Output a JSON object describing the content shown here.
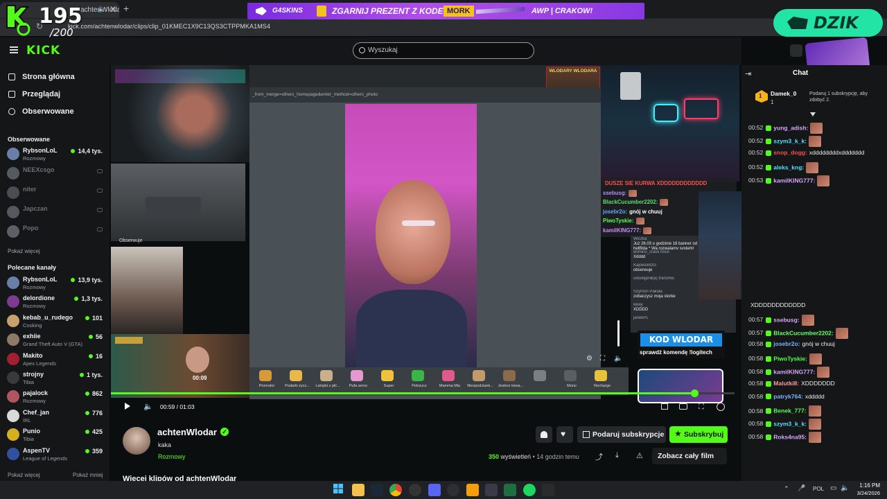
{
  "browser": {
    "tab_title": "achtenWlodar - Watch clip",
    "url": "kick.com/achtenwlodar/clips/clip_01KMEC1X9C13QS3CTPPMKA1MS4"
  },
  "overlay_counter": {
    "value": "195",
    "goal": "/200"
  },
  "promo_banner": {
    "brand": "G4SKINS",
    "text": "ZGARNIJ PREZENT Z KODEM",
    "code": "MORK",
    "tail": "AWP | CRAKOW!"
  },
  "dzik_badge": {
    "label": "DZIK"
  },
  "kick_header": {
    "logo": "KICK",
    "search_placeholder": "Wyszukaj"
  },
  "sidebar": {
    "nav": [
      {
        "label": "Strona główna",
        "icon": "home-icon"
      },
      {
        "label": "Przeglądaj",
        "icon": "browse-icon"
      },
      {
        "label": "Obserwowane",
        "icon": "heart-icon"
      }
    ],
    "followed_title": "Obserwowane",
    "followed": [
      {
        "name": "RybsonLoL",
        "category": "Rozmowy",
        "viewers": "14,4 tys.",
        "live": true,
        "color": "#6a7fa8"
      },
      {
        "name": "NEEXcsgo",
        "category": "",
        "viewers": "",
        "live": false,
        "color": "#555a60"
      },
      {
        "name": "niter",
        "category": "",
        "viewers": "",
        "live": false,
        "color": "#4a4e53"
      },
      {
        "name": "Japczan",
        "category": "",
        "viewers": "",
        "live": false,
        "color": "#55595e"
      },
      {
        "name": "Popo",
        "category": "",
        "viewers": "",
        "live": false,
        "color": "#5c5f63"
      }
    ],
    "show_more": "Pokaż więcej",
    "recommended_title": "Polecane kanały",
    "recommended": [
      {
        "name": "RybsonLoL",
        "category": "Rozmowy",
        "viewers": "13,9 tys.",
        "color": "#6a7fa8"
      },
      {
        "name": "delordione",
        "category": "Rozmowy",
        "viewers": "1,3 tys.",
        "color": "#7d3b8f"
      },
      {
        "name": "kebab_u_rudego",
        "category": "Cooking",
        "viewers": "101",
        "color": "#c8a070"
      },
      {
        "name": "exhiie",
        "category": "Grand Theft Auto V (GTA)",
        "viewers": "56",
        "color": "#8c7a66"
      },
      {
        "name": "Makito",
        "category": "Apex Legends",
        "viewers": "16",
        "color": "#a02030"
      },
      {
        "name": "strojny",
        "category": "Tibia",
        "viewers": "1 tys.",
        "color": "#3a3a3a"
      },
      {
        "name": "pajalock",
        "category": "Rozmowy",
        "viewers": "862",
        "color": "#b05560"
      },
      {
        "name": "Chef_jan",
        "category": "IRL",
        "viewers": "776",
        "color": "#d9d9d9"
      },
      {
        "name": "Punio",
        "category": "Tibia",
        "viewers": "425",
        "color": "#d4b020"
      },
      {
        "name": "AspenTV",
        "category": "League of Legends",
        "viewers": "359",
        "color": "#3050a0"
      }
    ],
    "footer_more": "Pokaż więcej",
    "footer_less": "Pokaż mniej"
  },
  "player": {
    "mini_timer": "00:09",
    "time": "00:59 / 01:03",
    "progress": 0.936
  },
  "stream_page": {
    "url_fragment": "_from_merge=others_homepage&enter_method=others_photo",
    "gifts": [
      "Promotor",
      "Podarki życz...",
      "Lampki z płć...",
      "Pufa serce",
      "Super",
      "Petrzucz",
      "Mamma Mia",
      "Niespodziank...",
      "Jestesi niesa...",
      "",
      "Mono",
      "Recharge"
    ],
    "kod_title": "KOD WLODAR",
    "kod_sub": "sprawdź komendę !logitech",
    "wloldary": "WLODARY WLODARA"
  },
  "overlay_chat": [
    {
      "user": "",
      "text": "DUSZE SIE KURWA XDDDDDDDDDDDD",
      "color": "#ff5050"
    },
    {
      "user": "ssebusg:",
      "text": "",
      "color": "#b48cff"
    },
    {
      "user": "BlackCucumber2202:",
      "text": "",
      "color": "#5ee06a"
    },
    {
      "user": "josebr2o:",
      "text": "gnój w chuuj",
      "color": "#6aa8ff"
    },
    {
      "user": "PiwoTyskie:",
      "text": "",
      "color": "#56ff56"
    },
    {
      "user": "kamilKING777:",
      "text": "",
      "color": "#c88cff"
    }
  ],
  "side_overlay": {
    "username_label": "Obserwuje",
    "chat": [
      {
        "user": "Wiczka",
        "text": "Już 26.03 o godzinie 18 banner od hellfilda * Wa rozwalamy system!"
      },
      {
        "user": "domino_crack hous",
        "text": "Xdddd"
      },
      {
        "user": "KajowskiOG",
        "text": "obserwuje"
      },
      {
        "user": "udostępnił(a) transmis",
        "text": ""
      },
      {
        "user": "Szymon Pakoła",
        "text": "zobaczysz moja storke"
      },
      {
        "user": "kewy",
        "text": "XDDDD"
      },
      {
        "user": "janekPL",
        "text": ""
      }
    ]
  },
  "chat": {
    "header": "Chat",
    "top_supporter": {
      "name": "Damek_0",
      "count": "1"
    },
    "subgift_prompt": "Podaruj 1 subskrypcję, aby zdobyć 2.",
    "messages_top": [
      {
        "time": "00:52",
        "user": "yung_adish:",
        "text": "",
        "color": "#d7a7ff",
        "emote": true
      },
      {
        "time": "00:52",
        "user": "szym3_k_k:",
        "text": "",
        "color": "#56e0ff",
        "emote": true
      },
      {
        "time": "00:52",
        "user": "snop_dogg:",
        "text": "xddddddddxddddddd",
        "color": "#ff4d4d",
        "emote": false
      },
      {
        "time": "00:52",
        "user": "aleks_kng:",
        "text": "",
        "color": "#56e0ff",
        "emote": true
      },
      {
        "time": "00:53",
        "user": "kamilKING777:",
        "text": "",
        "color": "#d7a7ff",
        "emote": true
      }
    ],
    "messages_bottom": [
      {
        "time": "",
        "user": "",
        "text": "XDDDDDDDDDDDD",
        "color": "#eee",
        "emote": false
      },
      {
        "time": "00:57",
        "user": "ssebusg:",
        "text": "",
        "color": "#d7a7ff",
        "emote": true
      },
      {
        "time": "00:57",
        "user": "BlackCucumber2202:",
        "text": "",
        "color": "#6cff6c",
        "emote": true
      },
      {
        "time": "00:58",
        "user": "josebr2o:",
        "text": "gnój w chuuj",
        "color": "#7fb2ff",
        "emote": false
      },
      {
        "time": "00:58",
        "user": "PiwoTyskie:",
        "text": "",
        "color": "#56ff56",
        "emote": true
      },
      {
        "time": "00:58",
        "user": "kamilKING777:",
        "text": "",
        "color": "#d7a7ff",
        "emote": true
      },
      {
        "time": "00:58",
        "user": "Malutki8:",
        "text": "XDDDDDDD",
        "color": "#ff9b9b",
        "emote": false
      },
      {
        "time": "00:58",
        "user": "patryk764:",
        "text": "xddddd",
        "color": "#7fb2ff",
        "emote": false
      },
      {
        "time": "00:58",
        "user": "Benek_777:",
        "text": "",
        "color": "#56ff56",
        "emote": true
      },
      {
        "time": "00:58",
        "user": "szym3_k_k:",
        "text": "",
        "color": "#56e0ff",
        "emote": true
      },
      {
        "time": "00:58",
        "user": "Roks4na95:",
        "text": "",
        "color": "#d7a7ff",
        "emote": true
      }
    ]
  },
  "clip_info": {
    "channel": "achtenWlodar",
    "title": "kaka",
    "category": "Rozmowy",
    "views_count": "350",
    "views_label": "wyświetleń",
    "age": "• 14 godzin temu",
    "gift_sub_button": "Podaruj subskrypcje",
    "subscribe_button": "Subskrybuj",
    "watch_full_button": "Zobacz cały film",
    "more_clips": "Więcej klipów od achtenWlodar"
  },
  "taskbar": {
    "lang": "POL",
    "time": "1:16 PM",
    "date": "3/24/2026"
  },
  "colors": {
    "kick_green": "#53fc18",
    "chat_bg": "#141617",
    "dzik": "#22e5a5"
  }
}
